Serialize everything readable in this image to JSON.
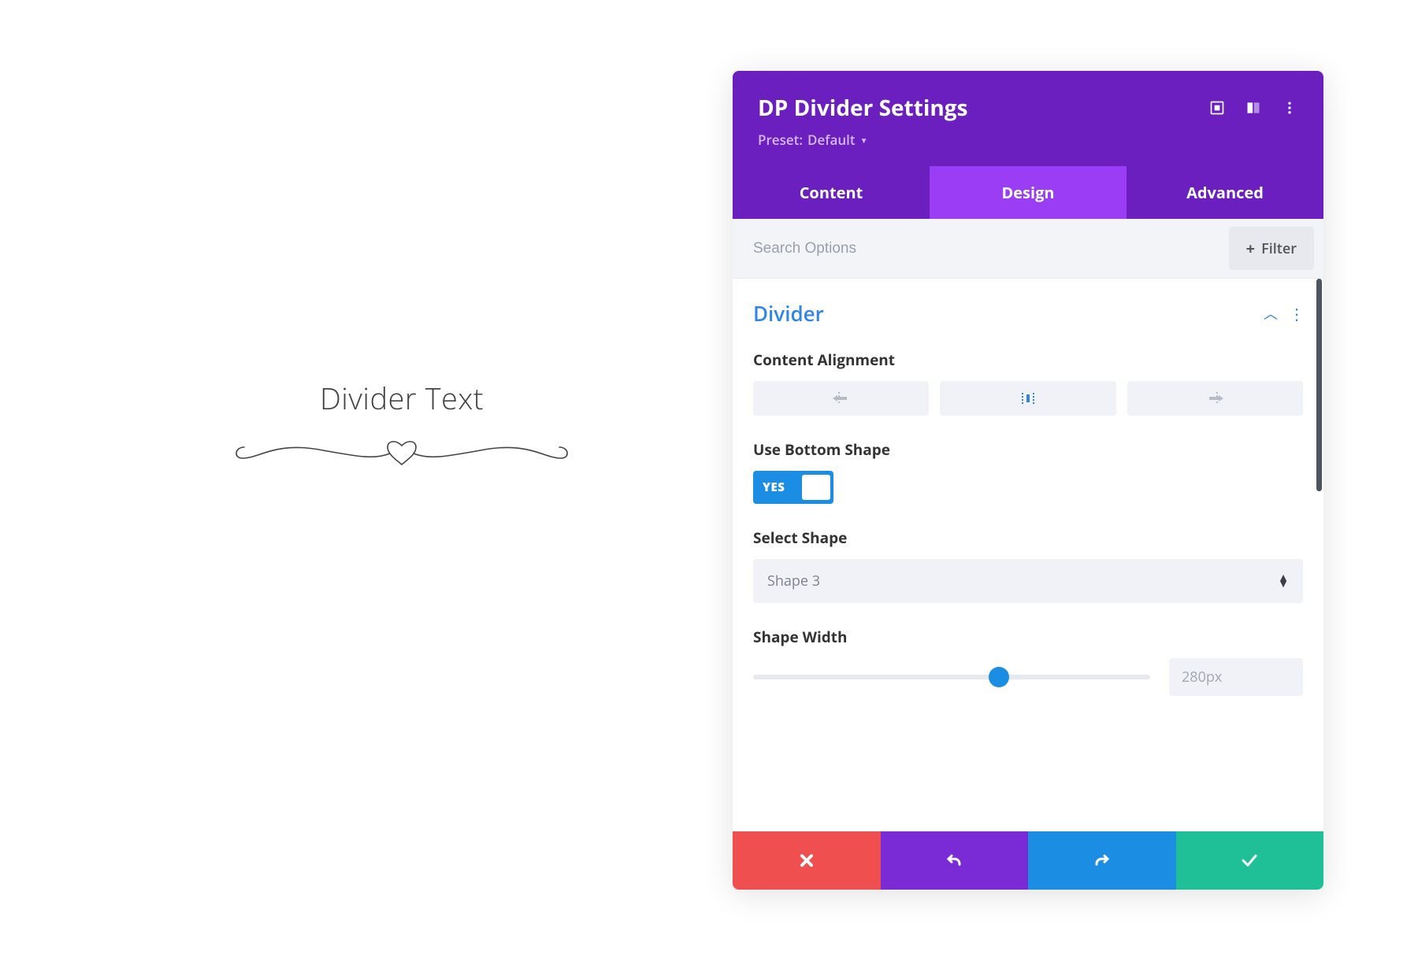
{
  "preview": {
    "text": "Divider Text"
  },
  "panel": {
    "title": "DP Divider Settings",
    "preset_prefix": "Preset:",
    "preset_value": "Default"
  },
  "tabs": {
    "content": "Content",
    "design": "Design",
    "advanced": "Advanced"
  },
  "search": {
    "placeholder": "Search Options",
    "filter_label": "Filter"
  },
  "section": {
    "title": "Divider"
  },
  "fields": {
    "content_alignment": {
      "label": "Content Alignment"
    },
    "use_bottom_shape": {
      "label": "Use Bottom Shape",
      "value_label": "YES"
    },
    "select_shape": {
      "label": "Select Shape",
      "value": "Shape 3"
    },
    "shape_width": {
      "label": "Shape Width",
      "value": "280px",
      "percent": 62
    }
  }
}
